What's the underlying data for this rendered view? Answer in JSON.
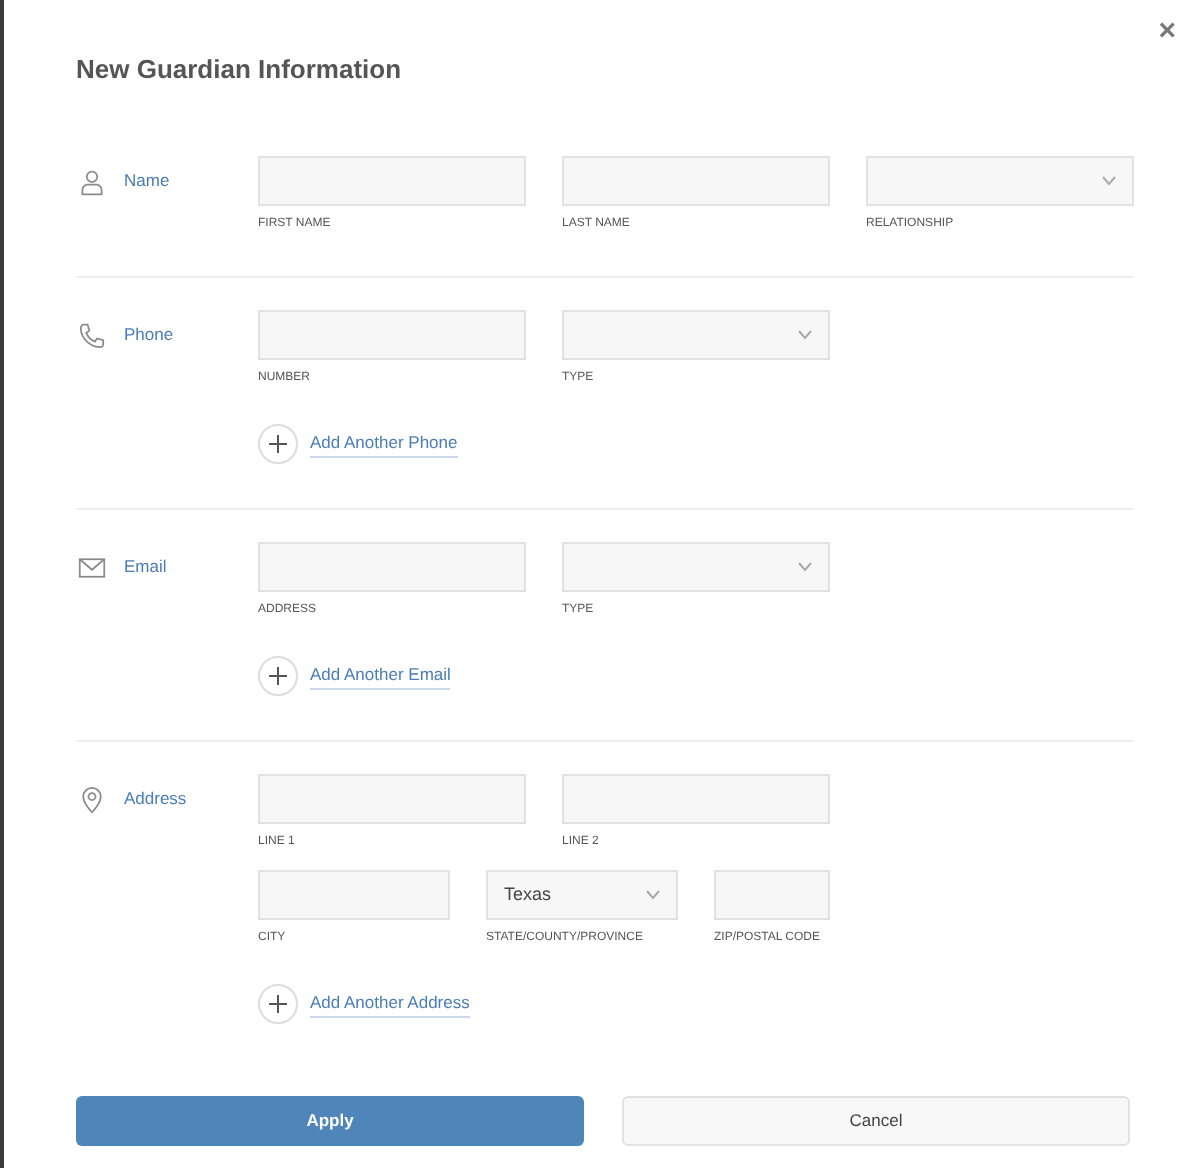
{
  "dialog": {
    "title": "New Guardian Information",
    "close": "×"
  },
  "sections": [
    {
      "label": "Name",
      "rows": [
        [
          {
            "kind": "text",
            "caption": "FIRST NAME"
          },
          {
            "kind": "text",
            "caption": "LAST NAME"
          },
          {
            "kind": "select",
            "caption": "RELATIONSHIP"
          }
        ]
      ]
    },
    {
      "label": "Phone",
      "rows": [
        [
          {
            "kind": "text",
            "caption": "NUMBER"
          },
          {
            "kind": "select",
            "caption": "TYPE"
          }
        ]
      ],
      "add_link": "Add Another Phone"
    },
    {
      "label": "Email",
      "rows": [
        [
          {
            "kind": "text",
            "caption": "ADDRESS"
          },
          {
            "kind": "select",
            "caption": "TYPE"
          }
        ]
      ],
      "add_link": "Add Another Email"
    },
    {
      "label": "Address",
      "rows": [
        [
          {
            "kind": "text",
            "caption": "LINE 1"
          },
          {
            "kind": "text",
            "caption": "LINE 2"
          }
        ],
        [
          {
            "kind": "text",
            "caption": "CITY"
          },
          {
            "kind": "select",
            "caption": "STATE/COUNTY/PROVINCE",
            "value": "Texas"
          },
          {
            "kind": "text",
            "caption": "ZIP/POSTAL CODE"
          }
        ]
      ],
      "add_link": "Add Another Address"
    }
  ],
  "buttons": [
    {
      "kind": "primary",
      "label": "Apply"
    },
    {
      "kind": "secondary",
      "label": "Cancel"
    }
  ]
}
